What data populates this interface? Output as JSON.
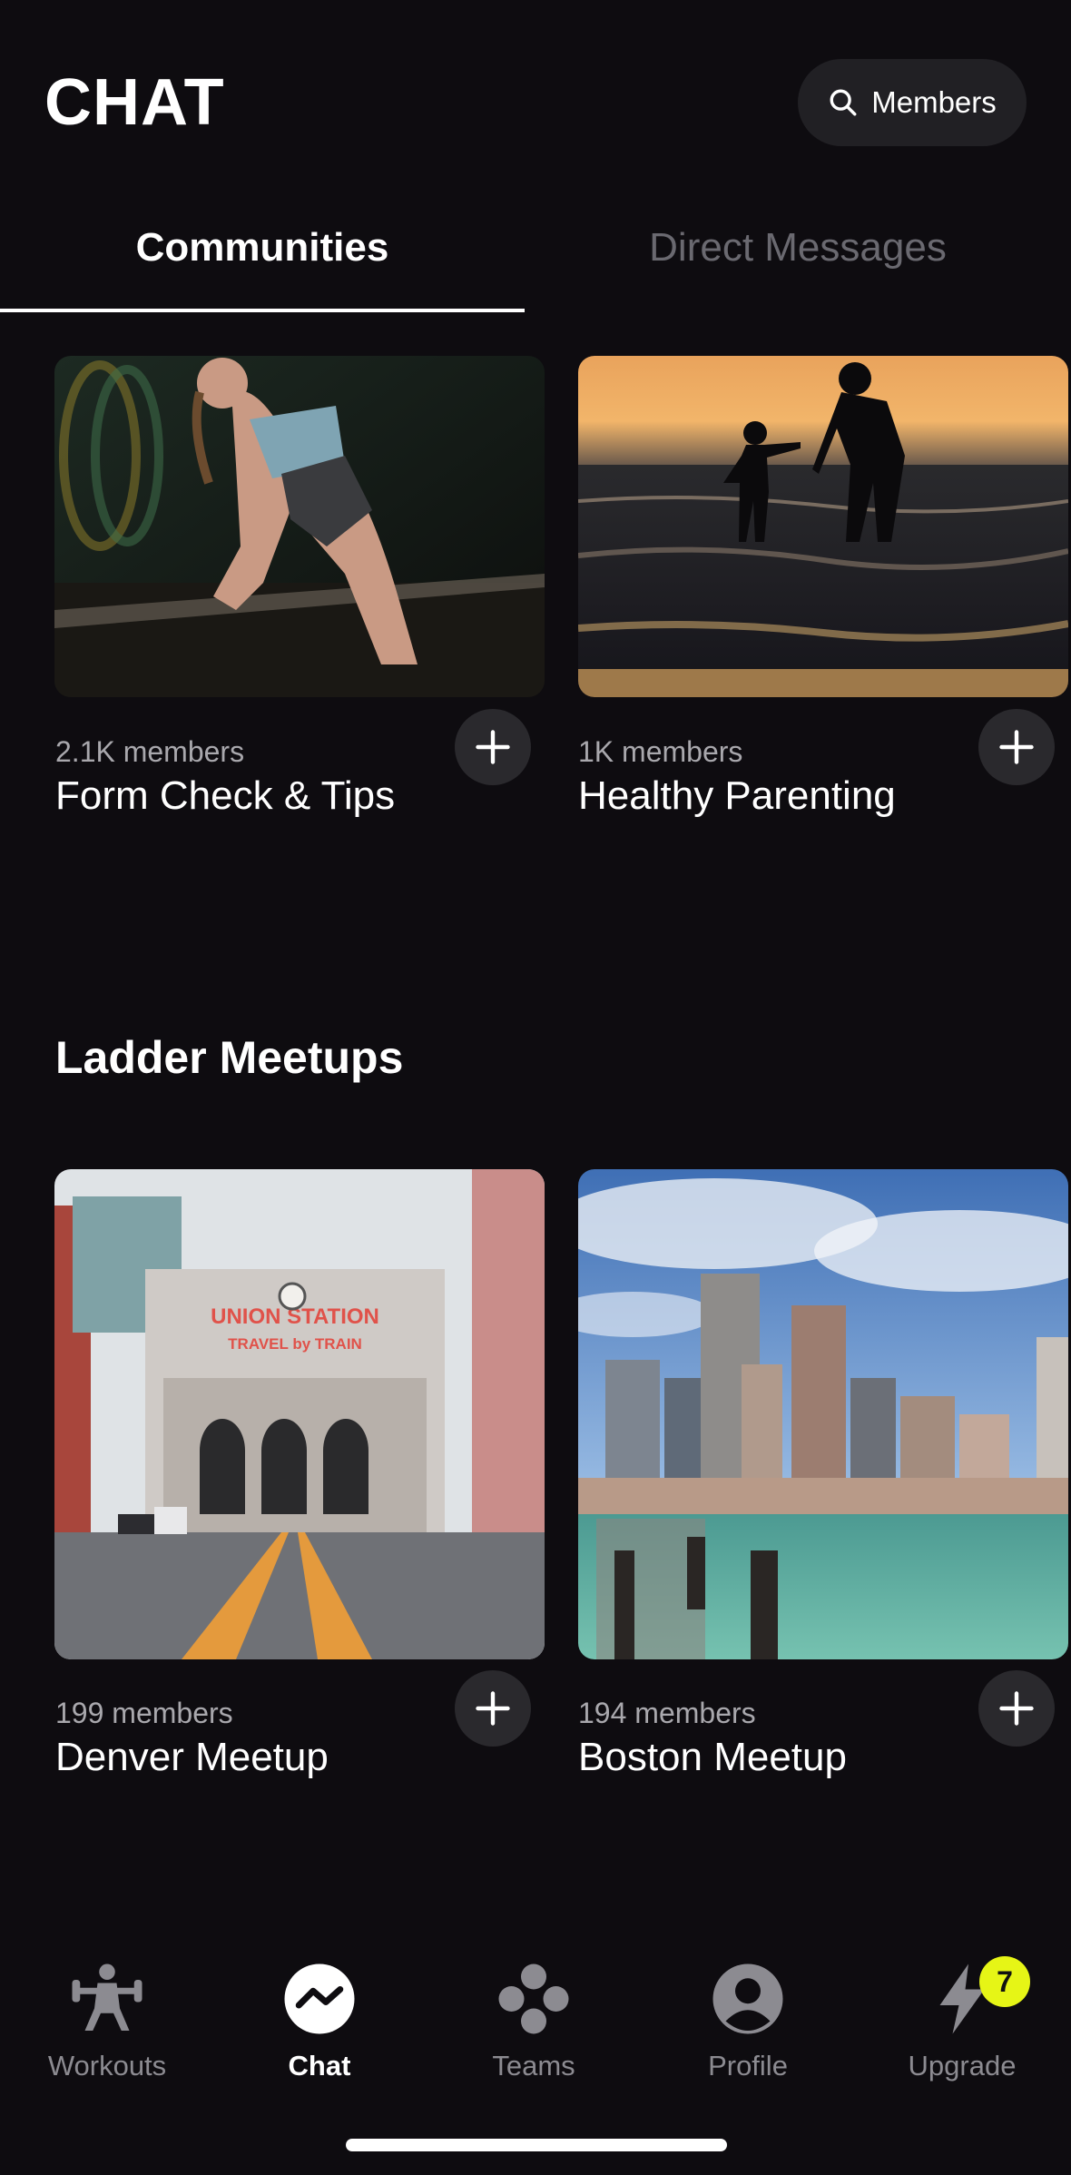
{
  "header": {
    "title": "CHAT",
    "members_button": "Members"
  },
  "tabs": [
    {
      "label": "Communities",
      "active": true
    },
    {
      "label": "Direct Messages",
      "active": false
    }
  ],
  "communities": [
    {
      "members": "2.1K members",
      "title": "Form Check & Tips"
    },
    {
      "members": "1K members",
      "title": "Healthy Parenting"
    }
  ],
  "ladder_meetups": {
    "section_title": "Ladder Meetups",
    "items": [
      {
        "members": "199 members",
        "title": "Denver Meetup"
      },
      {
        "members": "194 members",
        "title": "Boston Meetup"
      }
    ]
  },
  "nav": [
    {
      "label": "Workouts",
      "icon": "workouts-icon"
    },
    {
      "label": "Chat",
      "icon": "chat-icon",
      "active": true
    },
    {
      "label": "Teams",
      "icon": "teams-icon"
    },
    {
      "label": "Profile",
      "icon": "profile-icon"
    },
    {
      "label": "Upgrade",
      "icon": "upgrade-icon",
      "badge": "7"
    }
  ],
  "colors": {
    "background": "#0e0c10",
    "badge": "#e6f516",
    "inactive": "#8c8b91"
  }
}
